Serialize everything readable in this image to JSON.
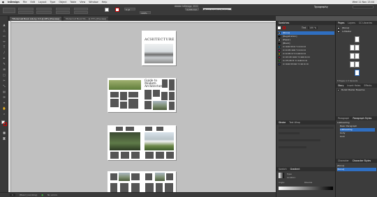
{
  "menubar": {
    "apple": "",
    "items": [
      "InDesign",
      "File",
      "Edit",
      "Layout",
      "Type",
      "Object",
      "Table",
      "View",
      "Window",
      "Help"
    ],
    "right": "Wed 11 Nov  13:44"
  },
  "app_title": "Adobe InDesign 2022",
  "workspace": "Typography",
  "control": {
    "fill_label": "Fill",
    "stroke_value": "0 pt",
    "percent": "100%",
    "frame_value": "4.233 mm",
    "style_value": "[Basic Graphics Frame]"
  },
  "tabs": [
    {
      "label": "*Modernist Book Ads by 3.5 @ 28% [Preview]",
      "active": true
    },
    {
      "label": "Modernist Book Mo... @ 35% [Preview]",
      "active": false
    }
  ],
  "cover_title": "ACHITECTURE",
  "spread_title_lines": [
    "Guide to",
    "Modern",
    "Architecture"
  ],
  "swatches": {
    "title": "Swatches",
    "tint_label": "Tint",
    "tint_value": "100 %",
    "items": [
      {
        "name": "[None]",
        "color": "#ffffff",
        "selected": true
      },
      {
        "name": "[Registration]",
        "color": "#000000",
        "selected": false
      },
      {
        "name": "[Paper]",
        "color": "#ffffff",
        "selected": false
      },
      {
        "name": "[Black]",
        "color": "#000000",
        "selected": false
      },
      {
        "name": "C=100 M=0 Y=0 K=0",
        "color": "#00a0e3",
        "selected": false
      },
      {
        "name": "C=0 M=100 Y=0 K=0",
        "color": "#e2007a",
        "selected": false
      },
      {
        "name": "C=0 M=0 Y=100 K=0",
        "color": "#ffed00",
        "selected": false
      },
      {
        "name": "C=15 M=100 Y=100 K=0",
        "color": "#c8102e",
        "selected": false
      },
      {
        "name": "C=75 M=5 Y=100 K=0",
        "color": "#3aa935",
        "selected": false
      },
      {
        "name": "C=100 M=90 Y=10 K=0",
        "color": "#283a8f",
        "selected": false
      }
    ]
  },
  "mid_lower": {
    "tabs": [
      "Stroke",
      "Text Wrap"
    ],
    "gradient_tabs": [
      "Swatch",
      "Gradient"
    ],
    "gradient_fields": [
      "Type:",
      "Location:",
      "Angle:",
      "Reverse"
    ]
  },
  "pages_panel": {
    "tabs": [
      "Pages",
      "Layers",
      "CC Libraries"
    ],
    "pages_label": "8 Pages in 5 Spreads",
    "masters": [
      "[None]",
      "A-Master"
    ]
  },
  "styles_panel": {
    "tabs": [
      "Story",
      "Insert Holes",
      "Effects"
    ],
    "row1": "Bullet Master Baseline"
  },
  "paragraph_styles": {
    "tabs": [
      "Paragraph",
      "Paragraph Styles"
    ],
    "items": [
      "subheading",
      "Basic Paragraph",
      "subheading",
      "body",
      "bold"
    ],
    "selected_index": 2
  },
  "char_panel": {
    "tabs": [
      "Character",
      "Character Styles"
    ],
    "items": [
      "[None]"
    ]
  },
  "status": {
    "page": "1",
    "style": "[Basic] (working)",
    "errors": "No errors"
  }
}
